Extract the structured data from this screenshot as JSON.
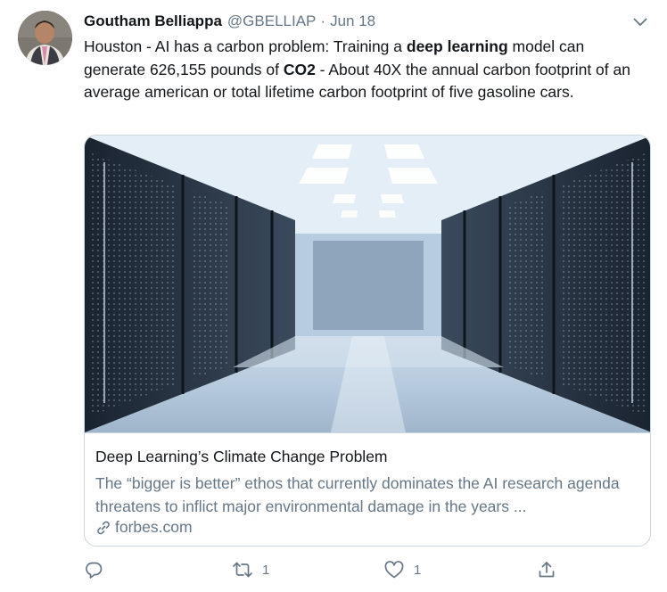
{
  "tweet": {
    "author_name": "Goutham Belliappa",
    "author_handle": "@GBELLIAP",
    "separator": "·",
    "date": "Jun 18",
    "text_parts": {
      "p1": "Houston - AI has a carbon problem: Training a ",
      "b1": "deep learning",
      "p2": " model can generate 626,155 pounds of ",
      "b2": "CO2",
      "p3": "  - About 40X the annual carbon footprint of an average american or total lifetime carbon footprint of five gasoline cars."
    },
    "card": {
      "title": "Deep Learning’s Climate Change Problem",
      "description": "The “bigger is better” ethos that currently dominates the AI research agenda threatens to inflict major environmental damage in the years ...",
      "domain": "forbes.com"
    },
    "actions": {
      "reply_count": "",
      "retweet_count": "1",
      "like_count": "1"
    }
  },
  "icons": {
    "caret": "chevron-down-icon",
    "link": "link-icon",
    "reply": "reply-icon",
    "retweet": "retweet-icon",
    "like": "heart-icon",
    "share": "share-icon"
  },
  "colors": {
    "text_primary": "#14171a",
    "text_secondary": "#657786",
    "border": "#ccd6dd"
  }
}
